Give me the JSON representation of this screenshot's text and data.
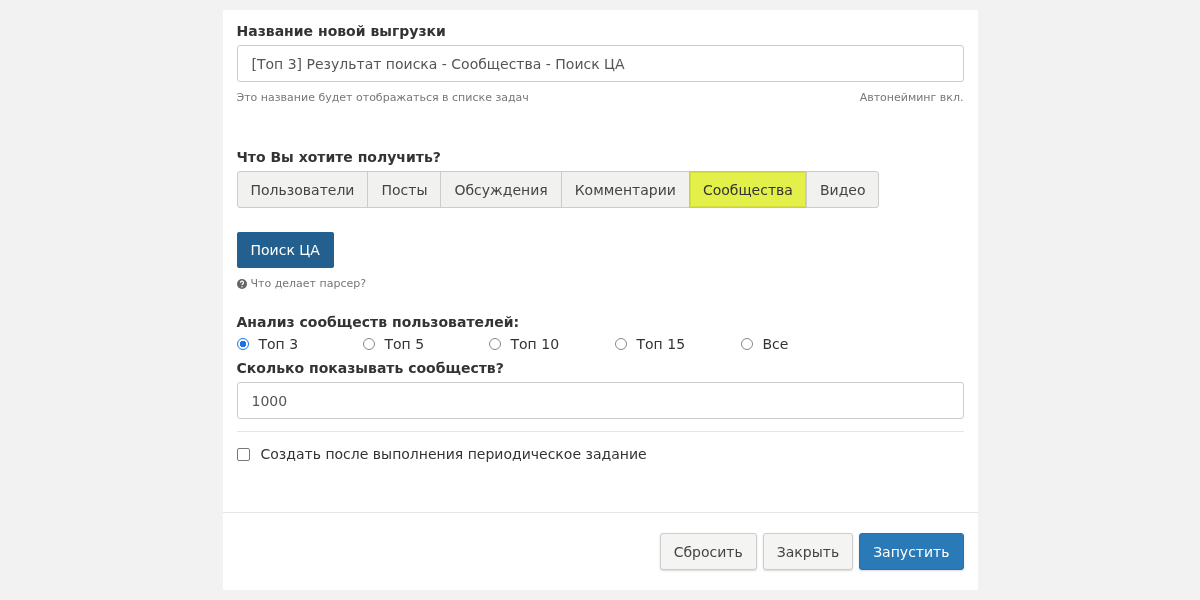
{
  "name_field": {
    "label": "Название новой выгрузки",
    "value": "[Топ 3] Результат поиска - Сообщества - Поиск ЦА",
    "hint": "Это название будет отображаться в списке задач",
    "autonaming": "Автонейминг вкл."
  },
  "type_question": "Что Вы хотите получить?",
  "tabs": [
    {
      "label": "Пользователи",
      "selected": false
    },
    {
      "label": "Посты",
      "selected": false
    },
    {
      "label": "Обсуждения",
      "selected": false
    },
    {
      "label": "Комментарии",
      "selected": false
    },
    {
      "label": "Сообщества",
      "selected": true
    },
    {
      "label": "Видео",
      "selected": false
    }
  ],
  "parser_button": "Поиск ЦА",
  "help_link": "Что делает парсер?",
  "analysis": {
    "label": "Анализ сообществ пользователей:",
    "options": [
      {
        "label": "Топ 3",
        "selected": true
      },
      {
        "label": "Топ 5",
        "selected": false
      },
      {
        "label": "Топ 10",
        "selected": false
      },
      {
        "label": "Топ 15",
        "selected": false
      },
      {
        "label": "Все",
        "selected": false
      }
    ]
  },
  "count_field": {
    "label": "Сколько показывать сообществ?",
    "value": "1000"
  },
  "periodic": {
    "label": "Создать после выполнения периодическое задание",
    "checked": false
  },
  "buttons": [
    {
      "label": "Сбросить",
      "kind": "default"
    },
    {
      "label": "Закрыть",
      "kind": "default"
    },
    {
      "label": "Запустить",
      "kind": "primary"
    }
  ]
}
